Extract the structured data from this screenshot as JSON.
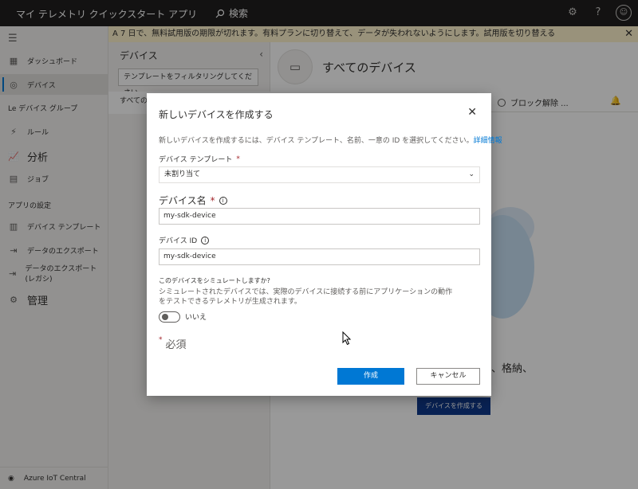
{
  "topbar": {
    "app_title": "マイ テレメトリ クイックスタート アプリ",
    "search_label": "検索",
    "icons": [
      "gear-icon",
      "help-icon",
      "profile-icon"
    ]
  },
  "banner": {
    "text": "A 7 日で、無料試用版の期限が切れます。有料プランに切り替えて、データが失われないようにします。試用版を切り替える"
  },
  "sidebar": {
    "items": [
      {
        "label": "ダッシュボード",
        "icon": "dashboard-icon"
      },
      {
        "label": "デバイス",
        "icon": "devices-icon",
        "active": true
      },
      {
        "label": "Le デバイス グループ",
        "icon": ""
      },
      {
        "label": "ルール",
        "icon": "rules-icon"
      },
      {
        "label": "分析",
        "icon": "analytics-icon"
      },
      {
        "label": "ジョブ",
        "icon": "jobs-icon"
      }
    ],
    "section_app_settings": "アプリの設定",
    "settings_items": [
      {
        "label": "デバイス テンプレート",
        "icon": "template-icon"
      },
      {
        "label": "データのエクスポート",
        "icon": "export-icon"
      },
      {
        "label": "データのエクスポート (レガシ)",
        "icon": "export-legacy-icon"
      },
      {
        "label": "管理",
        "icon": "admin-icon"
      }
    ],
    "footer": "Azure IoT Central"
  },
  "devices_panel": {
    "title": "デバイス",
    "filter_placeholder": "テンプレートをフィルタリングしてください",
    "all_devices": "すべてのデバイス"
  },
  "main": {
    "title": "すべてのデバイス",
    "unblock": "ブロック解除 ...",
    "bg_text": "監視、格納、",
    "bg_create_button": "デバイスを作成する"
  },
  "dialog": {
    "title": "新しいデバイスを作成する",
    "description": "新しいデバイスを作成するには、デバイス テンプレート、名前、一意の ID を選択してください。",
    "description_link": "詳細情報",
    "template_label": "デバイス テンプレート",
    "template_value": "未割り当て",
    "name_label": "デバイス名",
    "name_value": "my-sdk-device",
    "id_label": "デバイス ID",
    "id_value": "my-sdk-device",
    "simulate_question": "このデバイスをシミュレートしますか?",
    "simulate_desc": "シミュレートされたデバイスでは、実際のデバイスに接続する前にアプリケーションの動作をテストできるテレメトリが生成されます。",
    "toggle_label": "いいえ",
    "required_mark": "*",
    "required_note": "必須",
    "create_button": "作成",
    "cancel_button": "キャンセル"
  },
  "colors": {
    "accent": "#0078d4",
    "topbar": "#201f1e",
    "banner": "#fff4ce"
  }
}
